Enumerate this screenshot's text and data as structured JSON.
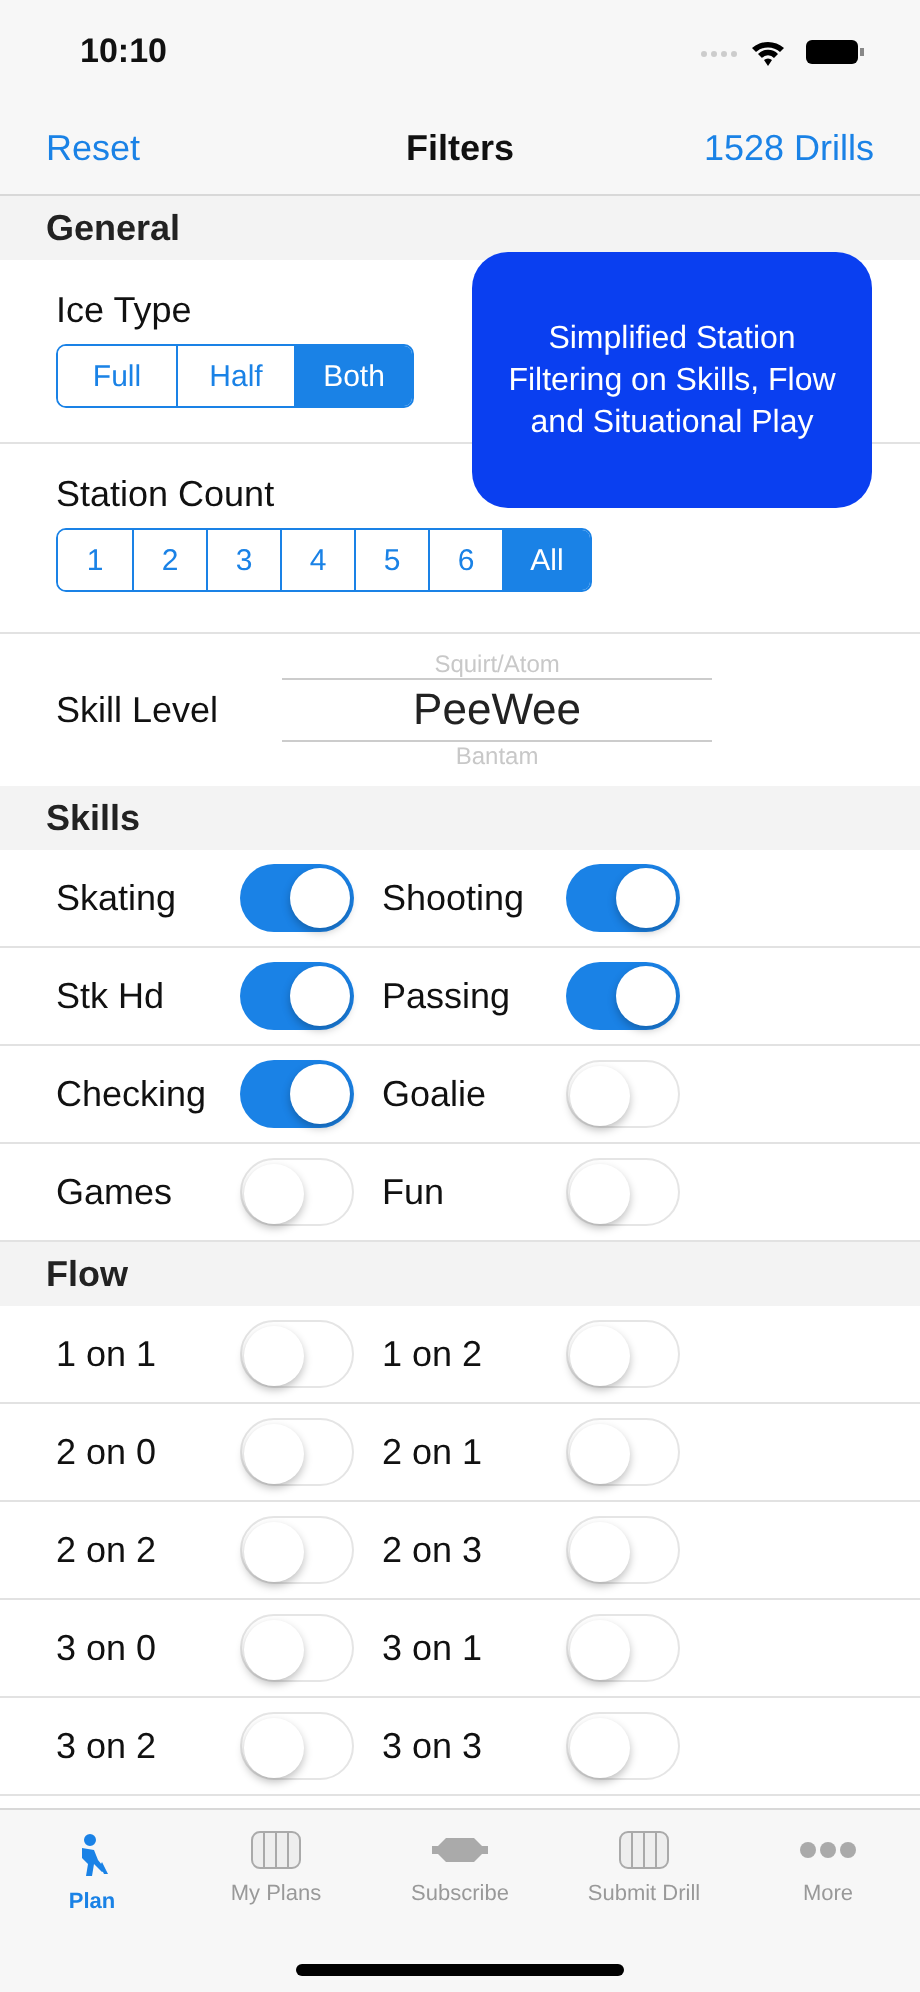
{
  "status_bar": {
    "time": "10:10"
  },
  "nav": {
    "left": "Reset",
    "title": "Filters",
    "right": "1528 Drills"
  },
  "general": {
    "title": "General",
    "ice_type": {
      "label": "Ice Type",
      "options": [
        {
          "label": "Full",
          "selected": false
        },
        {
          "label": "Half",
          "selected": false
        },
        {
          "label": "Both",
          "selected": true
        }
      ]
    },
    "station_count": {
      "label": "Station Count",
      "options": [
        {
          "label": "1",
          "selected": false
        },
        {
          "label": "2",
          "selected": false
        },
        {
          "label": "3",
          "selected": false
        },
        {
          "label": "4",
          "selected": false
        },
        {
          "label": "5",
          "selected": false
        },
        {
          "label": "6",
          "selected": false
        },
        {
          "label": "All",
          "selected": true
        }
      ]
    },
    "skill_level": {
      "label": "Skill Level",
      "options": [
        {
          "label": "Squirt/Atom",
          "selected": false
        },
        {
          "label": "PeeWee",
          "selected": true
        },
        {
          "label": "Bantam",
          "selected": false
        }
      ]
    }
  },
  "callout": "Simplified Station Filtering on Skills, Flow and Situational Play",
  "sections": [
    {
      "title": "Skills",
      "rows": [
        [
          {
            "label": "Skating",
            "on": true
          },
          {
            "label": "Shooting",
            "on": true
          }
        ],
        [
          {
            "label": "Stk Hd",
            "on": true
          },
          {
            "label": "Passing",
            "on": true
          }
        ],
        [
          {
            "label": "Checking",
            "on": true
          },
          {
            "label": "Goalie",
            "on": false
          }
        ],
        [
          {
            "label": "Games",
            "on": false
          },
          {
            "label": "Fun",
            "on": false
          }
        ]
      ]
    },
    {
      "title": "Flow",
      "rows": [
        [
          {
            "label": "1 on 1",
            "on": false
          },
          {
            "label": "1 on 2",
            "on": false
          }
        ],
        [
          {
            "label": "2 on 0",
            "on": false
          },
          {
            "label": "2 on 1",
            "on": false
          }
        ],
        [
          {
            "label": "2 on 2",
            "on": false
          },
          {
            "label": "2 on 3",
            "on": false
          }
        ],
        [
          {
            "label": "3 on 0",
            "on": false
          },
          {
            "label": "3 on 1",
            "on": false
          }
        ],
        [
          {
            "label": "3 on 2",
            "on": false
          },
          {
            "label": "3 on 3",
            "on": false
          }
        ]
      ]
    }
  ],
  "tab_bar": [
    {
      "label": "Plan",
      "kind": "player",
      "selected": true
    },
    {
      "label": "My Plans",
      "kind": "rink",
      "selected": false
    },
    {
      "label": "Subscribe",
      "kind": "puck",
      "selected": false
    },
    {
      "label": "Submit Drill",
      "kind": "rink",
      "selected": false
    },
    {
      "label": "More",
      "kind": "dots",
      "selected": false
    }
  ]
}
